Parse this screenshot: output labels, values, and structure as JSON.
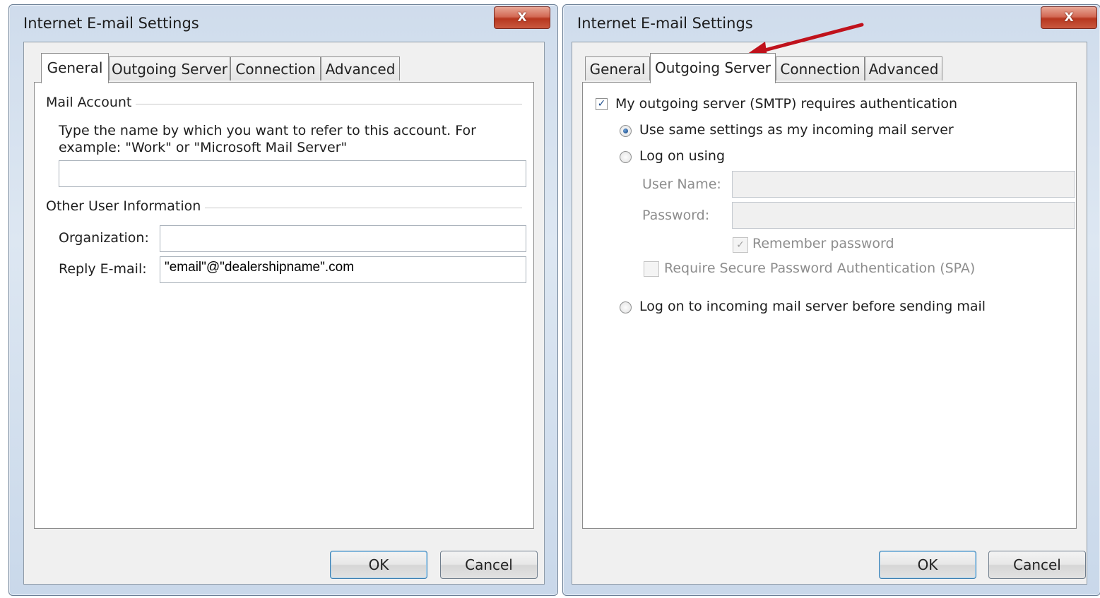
{
  "left_window": {
    "title": "Internet E-mail Settings",
    "close_label": "X",
    "tabs": [
      "General",
      "Outgoing Server",
      "Connection",
      "Advanced"
    ],
    "active_tab": "General",
    "mail_account": {
      "group_label": "Mail Account",
      "description_line1": "Type the name by which you want to refer to this account. For",
      "description_line2": "example: \"Work\" or \"Microsoft Mail Server\"",
      "account_name_value": ""
    },
    "other_user_info": {
      "group_label": "Other User Information",
      "organization_label": "Organization:",
      "organization_value": "",
      "reply_email_label": "Reply E-mail:",
      "reply_email_value": "\"email\"@\"dealershipname\".com"
    },
    "ok_label": "OK",
    "cancel_label": "Cancel"
  },
  "right_window": {
    "title": "Internet E-mail Settings",
    "close_label": "X",
    "tabs": [
      "General",
      "Outgoing Server",
      "Connection",
      "Advanced"
    ],
    "active_tab": "Outgoing Server",
    "smtp_auth_label": "My outgoing server (SMTP) requires authentication",
    "smtp_auth_checked": true,
    "option_same_settings": "Use same settings as my incoming mail server",
    "option_log_on_using": "Log on using",
    "user_name_label": "User Name:",
    "user_name_value": "",
    "password_label": "Password:",
    "password_value": "",
    "remember_password_label": "Remember password",
    "remember_password_checked": true,
    "spa_label": "Require Secure Password Authentication (SPA)",
    "spa_checked": false,
    "option_log_on_incoming": "Log on to incoming mail server before sending mail",
    "selected_option": "Use same settings as my incoming mail server",
    "ok_label": "OK",
    "cancel_label": "Cancel"
  },
  "annotation": {
    "arrow_color": "#c0121c",
    "arrow_target": "Outgoing Server tab"
  }
}
